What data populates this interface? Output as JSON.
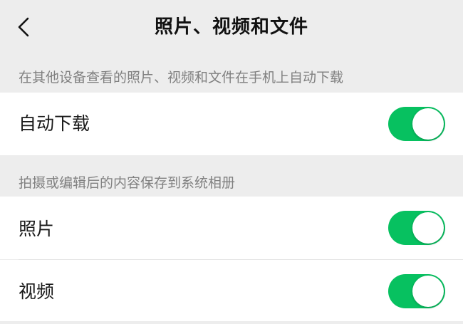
{
  "header": {
    "title": "照片、视频和文件",
    "back_icon": "chevron-left-icon"
  },
  "sections": [
    {
      "header": "在其他设备查看的照片、视频和文件在手机上自动下载",
      "items": [
        {
          "label": "自动下载",
          "enabled": true
        }
      ]
    },
    {
      "header": "拍摄或编辑后的内容保存到系统相册",
      "items": [
        {
          "label": "照片",
          "enabled": true
        },
        {
          "label": "视频",
          "enabled": true
        }
      ]
    }
  ],
  "colors": {
    "background": "#ededed",
    "switch_on": "#07c160",
    "cell": "#ffffff"
  }
}
